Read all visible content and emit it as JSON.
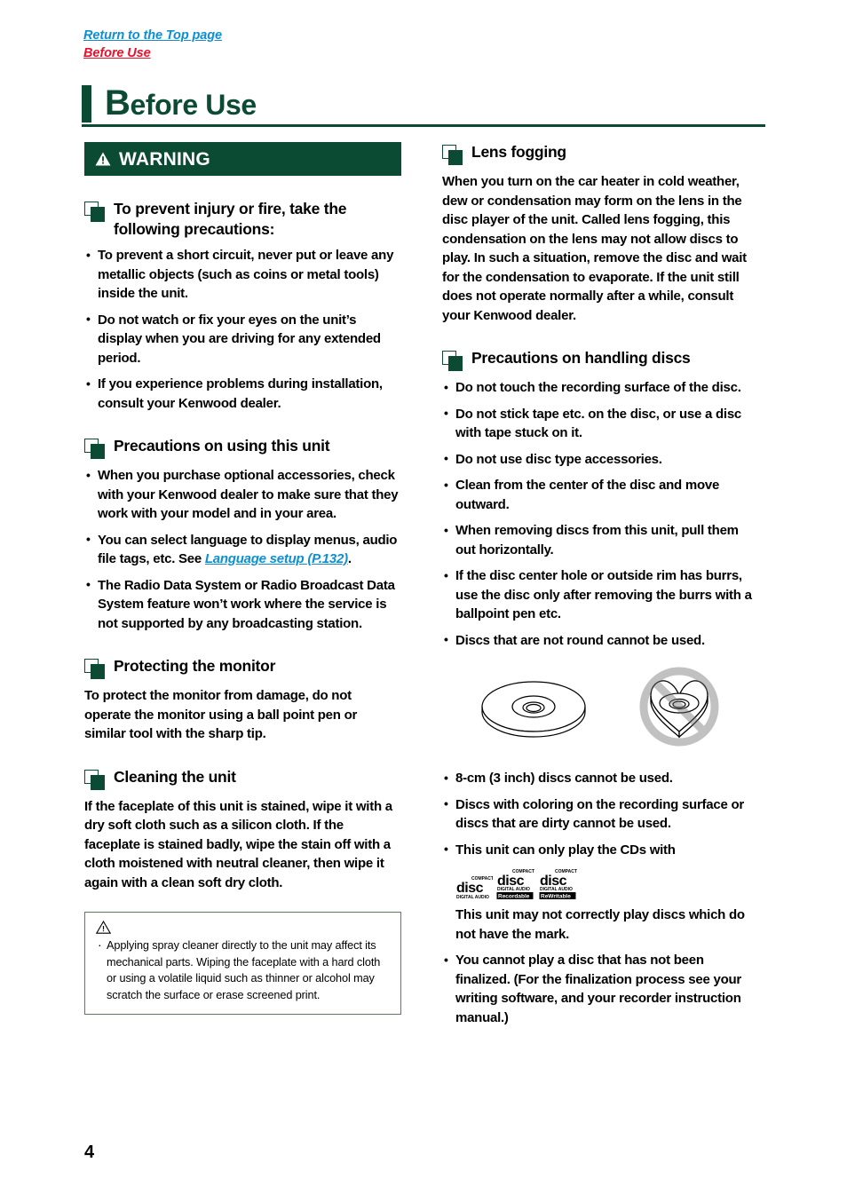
{
  "breadcrumb": {
    "top_link": "Return to the Top page",
    "current": "Before Use"
  },
  "header": {
    "title_cap": "B",
    "title_rest": "efore Use"
  },
  "colors": {
    "brand_green": "#0b4a33",
    "link_blue": "#0d8fd1",
    "current_red": "#e8112d",
    "caution_border": "#5c7a62"
  },
  "warning_banner": {
    "label": "WARNING",
    "icon": "warning-triangle-icon"
  },
  "left_column": {
    "sections": [
      {
        "id": "prevent-injury",
        "icon": "section-square-icon",
        "title": "To prevent injury or fire, take the following precautions:",
        "bullets": [
          "To prevent a short circuit, never put or leave any metallic objects (such as coins or metal tools) inside the unit.",
          "Do not watch or fix your eyes on the unit’s display when you are driving for any extended period.",
          "If you experience problems during installation, consult your Kenwood dealer."
        ]
      },
      {
        "id": "precautions-using-unit",
        "icon": "section-square-icon",
        "title": "Precautions on using this unit",
        "bullets": [
          "When you purchase optional accessories, check with your Kenwood dealer to make sure that they work with your model and in your area.",
          "The Radio Data System or Radio Broadcast Data System feature won’t work where the service is not supported by any broadcasting station."
        ],
        "bullet_with_link": {
          "before": "You can select language to display menus, audio file tags, etc. See ",
          "link_text": "Language setup (P.132)",
          "after": "."
        }
      },
      {
        "id": "protecting-monitor",
        "icon": "section-square-icon",
        "title": "Protecting the monitor",
        "paragraph": "To protect the monitor from damage, do not operate the monitor using a ball point pen or similar tool with the sharp tip."
      },
      {
        "id": "cleaning-unit",
        "icon": "section-square-icon",
        "title": "Cleaning the unit",
        "paragraph": "If the faceplate of this unit is stained, wipe it with a dry soft cloth such as a silicon cloth. If the faceplate is stained badly, wipe the stain off with a cloth moistened with neutral cleaner, then wipe it again with a clean soft dry cloth."
      }
    ],
    "caution_box": {
      "icon": "caution-triangle-icon",
      "text": "Applying spray cleaner directly to the unit may affect its mechanical parts. Wiping the faceplate with a hard cloth or using a volatile liquid such as thinner or alcohol may scratch the surface or erase screened print."
    }
  },
  "right_column": {
    "sections": [
      {
        "id": "lens-fogging",
        "icon": "section-square-icon",
        "title": "Lens fogging",
        "paragraph": "When you turn on the car heater in cold weather, dew or condensation may form on the lens in the disc player of the unit. Called lens fogging, this condensation on the lens may not allow discs to play. In such a situation, remove the disc and wait for the condensation to evaporate. If the unit still does not operate normally after a while, consult your Kenwood dealer."
      },
      {
        "id": "precautions-handling-discs",
        "icon": "section-square-icon",
        "title": "Precautions on handling discs",
        "bullets_before_figure": [
          "Do not touch the recording surface of the disc.",
          "Do not stick tape etc. on the disc, or use a disc with tape stuck on it.",
          "Do not use disc type accessories.",
          "Clean from the center of the disc and move outward.",
          "When removing discs from this unit, pull them out horizontally.",
          "If the disc center hole or outside rim has burrs, use the disc only after removing the burrs with a ballpoint pen etc.",
          "Discs that are not round cannot be used."
        ],
        "figures": [
          {
            "id": "round-disc",
            "alt": "round-disc-illustration"
          },
          {
            "id": "heart-disc-prohibited",
            "alt": "heart-shaped-disc-prohibited-illustration"
          }
        ],
        "bullets_after_figure": [
          "8-cm (3 inch) discs cannot be used.",
          "Discs with coloring on the recording surface or discs that are dirty cannot be used."
        ],
        "cd_bullet": {
          "text": "This unit can only play the CDs with",
          "logos": [
            {
              "id": "compact-disc-digital-audio",
              "top": "COMPACT",
              "word": "disc",
              "bottom": "DIGITAL AUDIO",
              "tag": ""
            },
            {
              "id": "compact-disc-recordable",
              "top": "COMPACT",
              "word": "disc",
              "bottom": "DIGITAL AUDIO",
              "tag": "Recordable"
            },
            {
              "id": "compact-disc-rewritable",
              "top": "COMPACT",
              "word": "disc",
              "bottom": "DIGITAL AUDIO",
              "tag": "ReWritable"
            }
          ],
          "follow_up": "This unit may not correctly play discs which do not have the mark."
        },
        "final_bullets": [
          "You cannot play a disc that has not been finalized. (For the finalization process see your writing software, and your recorder instruction manual.)"
        ]
      }
    ]
  },
  "footer": {
    "page_number": "4"
  }
}
